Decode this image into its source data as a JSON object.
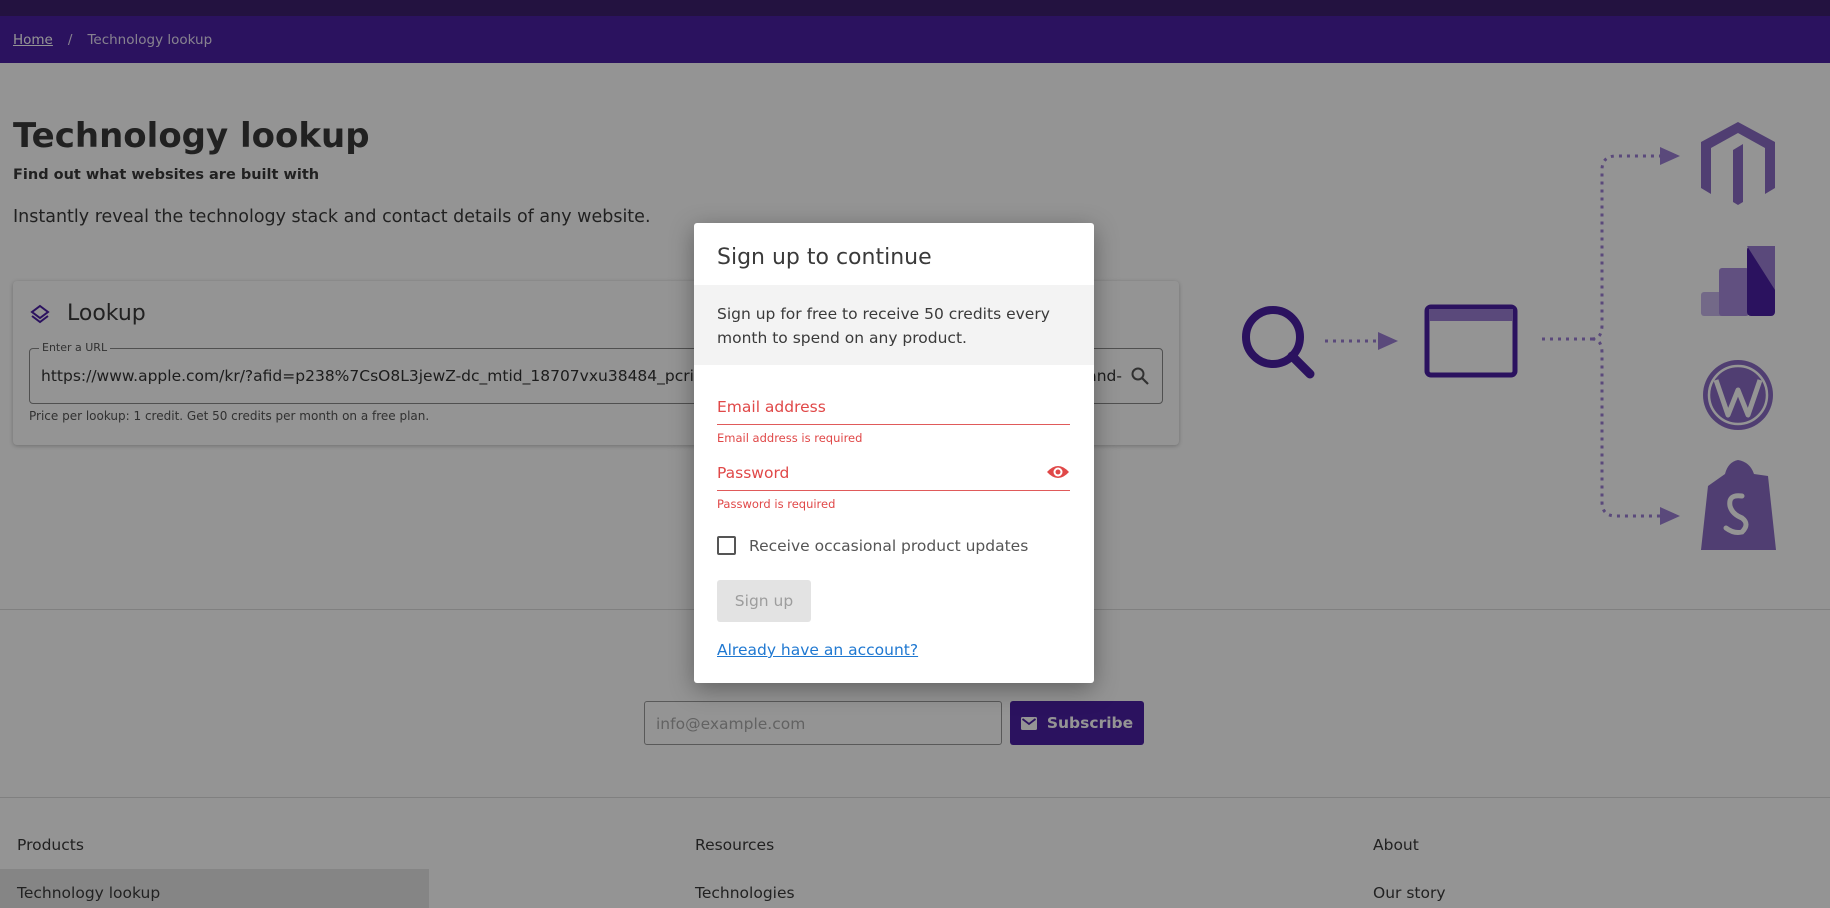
{
  "breadcrumb": {
    "home": "Home",
    "separator": "/",
    "current": "Technology lookup"
  },
  "hero": {
    "title": "Technology lookup",
    "subtitle": "Find out what websites are built with",
    "description": "Instantly reveal the technology stack and contact details of any website."
  },
  "lookup": {
    "heading": "Lookup",
    "field_label": "Enter a URL",
    "url_value": "https://www.apple.com/kr/?afid=p238%7CsO8L3jewZ-dc_mtid_18707vxu38484_pcrid_456",
    "url_tail": "and-",
    "price_note": "Price per lookup: 1 credit. Get 50 credits per month on a free plan."
  },
  "illustration": {
    "icons": [
      "magnifier-icon",
      "browser-window-icon",
      "magento-logo",
      "google-analytics-logo",
      "wordpress-logo",
      "shopify-logo"
    ]
  },
  "subscribe": {
    "placeholder": "info@example.com",
    "button": "Subscribe"
  },
  "footer": {
    "columns": [
      {
        "heading": "Products",
        "link": "Technology lookup"
      },
      {
        "heading": "Resources",
        "link": "Technologies"
      },
      {
        "heading": "About",
        "link": "Our story"
      }
    ]
  },
  "modal": {
    "title": "Sign up to continue",
    "info": "Sign up for free to receive 50 credits every month to spend on any product.",
    "email_label": "Email address",
    "email_error": "Email address is required",
    "password_label": "Password",
    "password_error": "Password is required",
    "checkbox_label": "Receive occasional product updates",
    "signup_button": "Sign up",
    "login_link": "Already have an account?"
  },
  "colors": {
    "brand_purple": "#4b1fa4",
    "error_red": "#e04848",
    "link_blue": "#1f78d1"
  }
}
